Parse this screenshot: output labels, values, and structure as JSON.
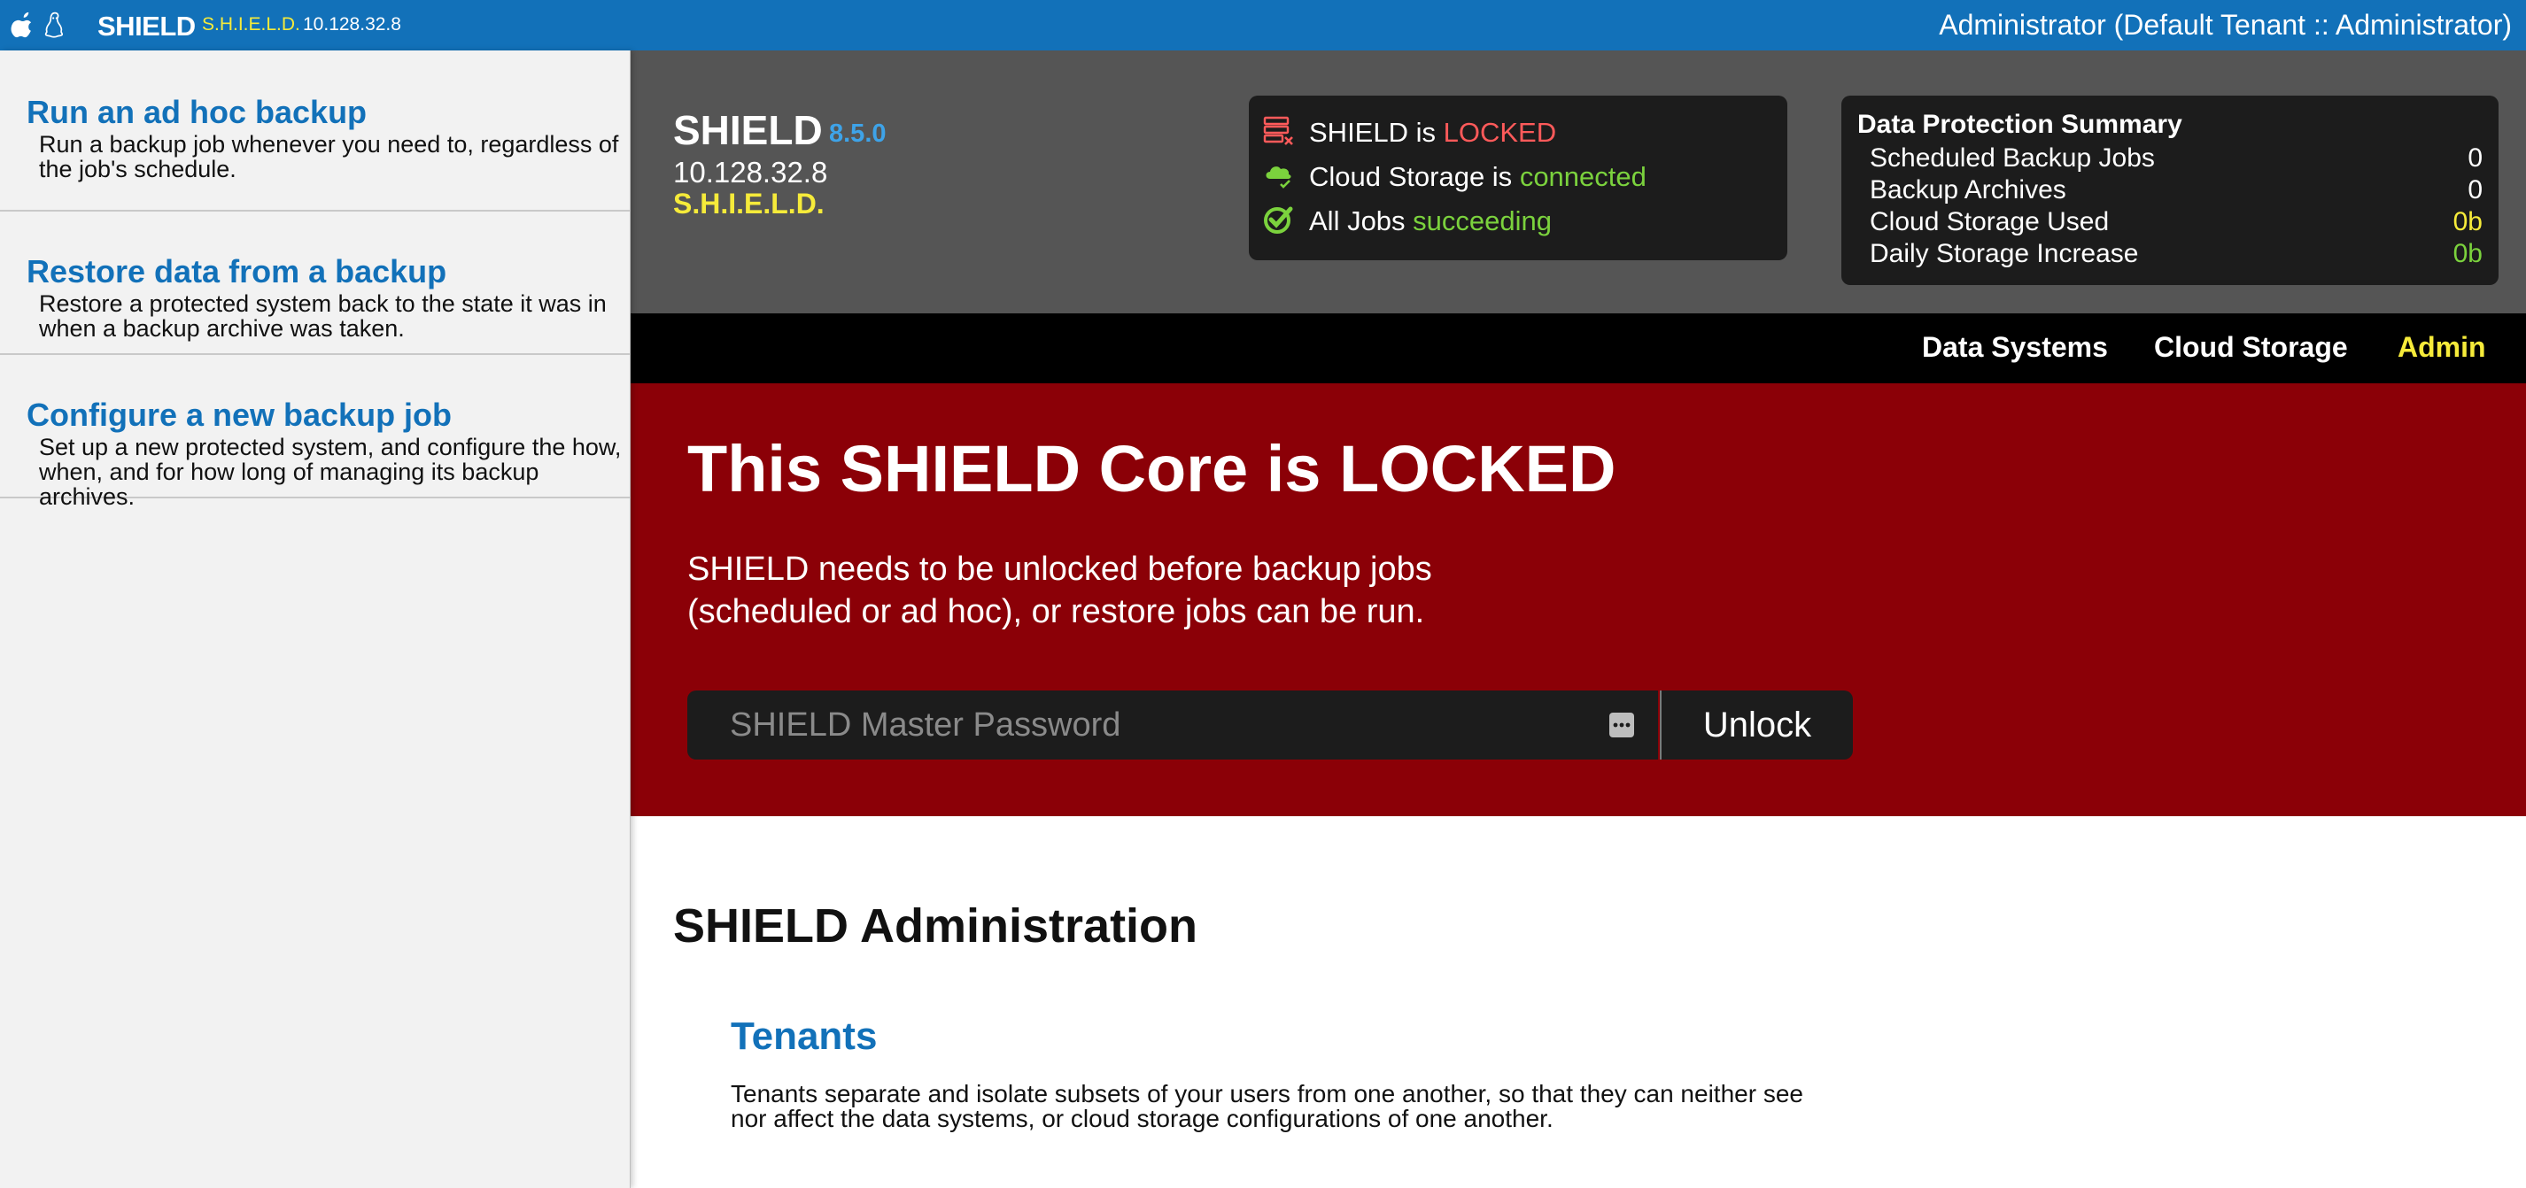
{
  "topbar": {
    "app_name": "SHIELD",
    "env_name": "S.H.I.E.L.D.",
    "ip": "10.128.32.8",
    "user": "Administrator (Default Tenant :: Administrator)",
    "icons": [
      "apple-icon",
      "linux-icon"
    ]
  },
  "sidebar": {
    "items": [
      {
        "title": "Run an ad hoc backup",
        "desc": "Run a backup job whenever you need to, regardless of the job's schedule."
      },
      {
        "title": "Restore data from a backup",
        "desc": "Restore a protected system back to the state it was in when a backup archive was taken."
      },
      {
        "title": "Configure a new backup job",
        "desc": "Set up a new protected system, and configure the how, when, and for how long of managing its backup archives."
      }
    ]
  },
  "header": {
    "name": "SHIELD",
    "version": "8.5.0",
    "ip": "10.128.32.8",
    "env": "S.H.I.E.L.D."
  },
  "status": {
    "locked": {
      "prefix": "SHIELD is ",
      "state": "LOCKED",
      "icon": "server-locked-icon"
    },
    "cloud": {
      "prefix": "Cloud Storage is ",
      "state": "connected",
      "icon": "cloud-check-icon"
    },
    "jobs": {
      "prefix": "All Jobs ",
      "state": "succeeding",
      "icon": "check-circle-icon"
    }
  },
  "summary": {
    "title": "Data Protection Summary",
    "rows": [
      {
        "label": "Scheduled Backup Jobs",
        "value": "0"
      },
      {
        "label": "Backup Archives",
        "value": "0"
      },
      {
        "label": "Cloud Storage Used",
        "value": "0b"
      },
      {
        "label": "Daily Storage Increase",
        "value": "0b"
      }
    ]
  },
  "nav": {
    "data_systems": "Data Systems",
    "cloud_storage": "Cloud Storage",
    "admin": "Admin"
  },
  "lock": {
    "title": "This SHIELD Core is LOCKED",
    "message": "SHIELD needs to be unlocked before backup jobs (scheduled or ad hoc), or restore jobs can be run.",
    "password_placeholder": "SHIELD Master Password",
    "unlock_label": "Unlock"
  },
  "admin": {
    "title": "SHIELD Administration",
    "tenants_heading": "Tenants",
    "tenants_desc": "Tenants separate and isolate subsets of your users from one another, so that they can neither see nor affect the data systems, or cloud storage configurations of one another."
  },
  "colors": {
    "brand_blue": "#1271b9",
    "header_gray": "#555555",
    "lock_red": "#8b0007",
    "accent_yellow": "#f6eb3a",
    "status_green": "#7bd23d",
    "status_red": "#ff5a5a",
    "version_blue": "#3ea3e8"
  }
}
